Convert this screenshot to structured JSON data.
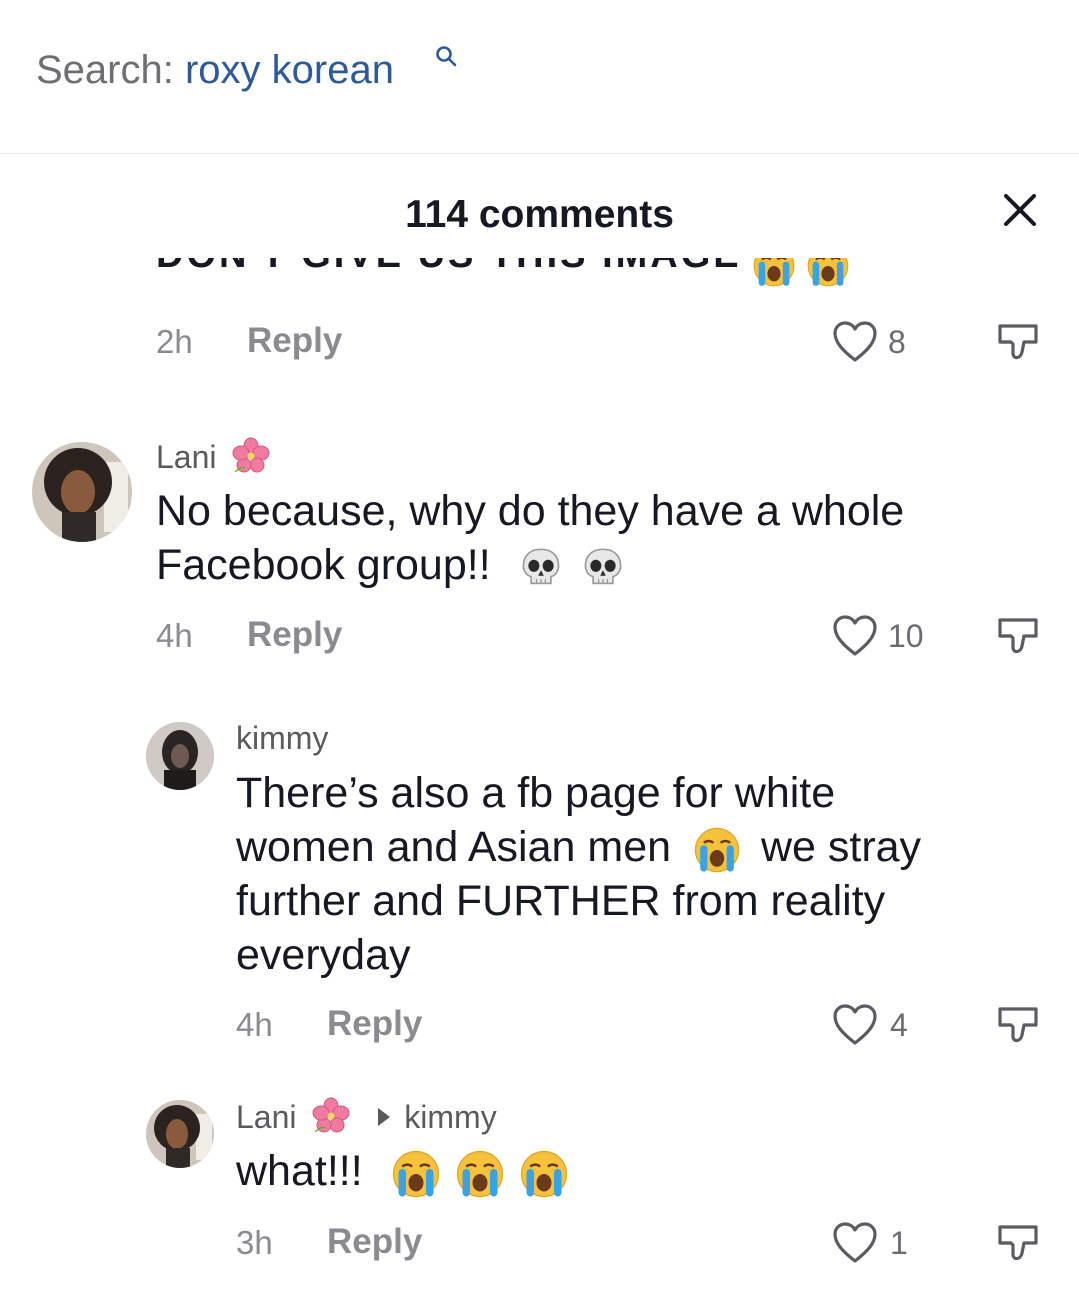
{
  "search": {
    "prefix": "Search:",
    "query": "roxy korean"
  },
  "header": {
    "title": "114 comments"
  },
  "comments": [
    {
      "text": "DON'T GIVE US THIS IMAGE",
      "time": "2h",
      "reply_label": "Reply",
      "likes": "8"
    },
    {
      "username": "Lani",
      "text_line1": "No because, why do they have a whole",
      "text_line2": "Facebook group!!",
      "time": "4h",
      "reply_label": "Reply",
      "likes": "10"
    },
    {
      "username": "kimmy",
      "text_line1": "There’s also a fb page for white",
      "text_line2a": "women and Asian men",
      "text_line2b": "we stray",
      "text_line3": "further and FURTHER from reality",
      "text_line4": "everyday",
      "time": "4h",
      "reply_label": "Reply",
      "likes": "4"
    },
    {
      "username": "Lani",
      "reply_to": "kimmy",
      "text": "what!!!",
      "time": "3h",
      "reply_label": "Reply",
      "likes": "1"
    }
  ],
  "colors": {
    "accent_link": "#2d5b9a",
    "text_primary": "#161823",
    "text_secondary": "#8a8b91"
  },
  "icons": [
    "search-icon",
    "close-icon",
    "heart-icon",
    "dislike-icon",
    "hibiscus-emoji",
    "skull-emoji",
    "crying-face-emoji"
  ]
}
